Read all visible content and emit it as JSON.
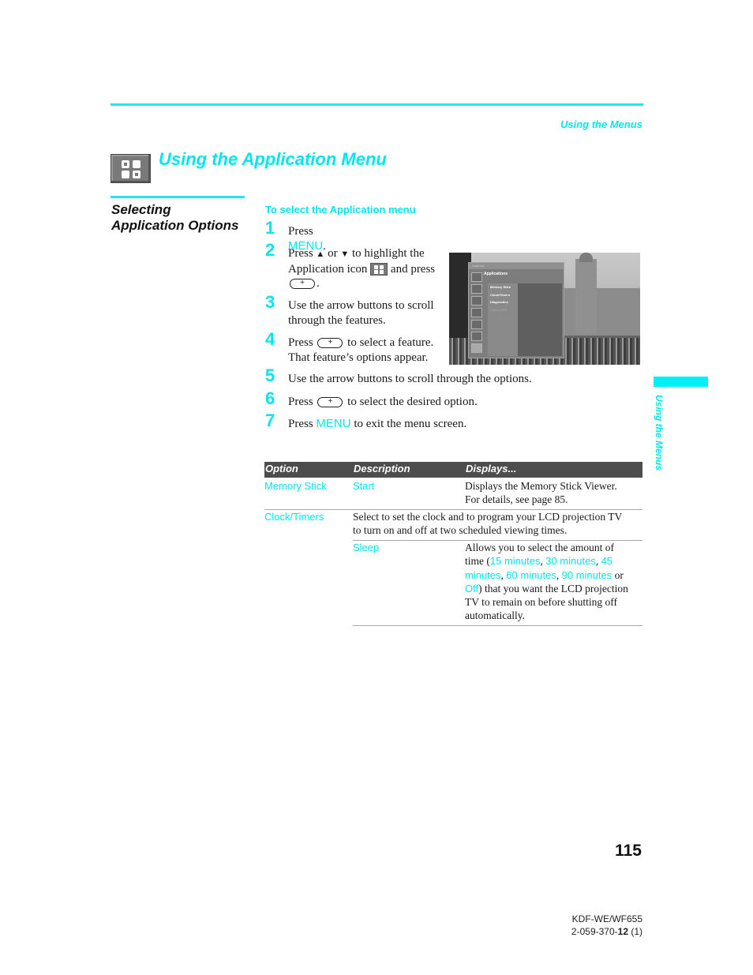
{
  "header": {
    "running_head": "Using the Menus",
    "page_title": "Using the Application Menu",
    "title_icon": "application-menu-icon"
  },
  "section": {
    "title_line1": "Selecting",
    "title_line2": "Application Options"
  },
  "procedure": {
    "heading": "To select the Application menu",
    "steps": [
      {
        "num": "1",
        "pre": "Press ",
        "kw": "MENU",
        "post": "."
      },
      {
        "num": "2",
        "line1_a": "Press ",
        "up_icon": "▲",
        "line1_b": " or ",
        "down_icon": "▼",
        "line1_c": " to highlight the",
        "line2_a": "Application icon ",
        "line2_b": " and press",
        "line3": "."
      },
      {
        "num": "3",
        "line1": "Use the arrow buttons to scroll",
        "line2": "through the features."
      },
      {
        "num": "4",
        "line1_a": "Press ",
        "line1_b": " to select a feature.",
        "line2": "That feature’s options appear."
      },
      {
        "num": "5",
        "text": "Use the arrow buttons to scroll through the options."
      },
      {
        "num": "6",
        "pre": "Press ",
        "post": " to select the desired option."
      },
      {
        "num": "7",
        "pre": "Press ",
        "kw": "MENU",
        "post": " to exit the menu screen."
      }
    ]
  },
  "tv_screen": {
    "top_bar": "Antenna",
    "menu_title": "Applications",
    "items": [
      "Memory Stick",
      "Clock/Timers",
      "Diagnostics",
      "CableCARD"
    ],
    "disabled_item": "CableCARD"
  },
  "table": {
    "headers": [
      "Option",
      "Description",
      "Displays..."
    ],
    "rows": [
      {
        "option": "Memory Stick",
        "description": "Start",
        "displays_line1": "Displays the Memory Stick Viewer.",
        "displays_line2": "For details, see page 85."
      },
      {
        "option": "Clock/Timers",
        "description_line1": "Select to set the clock and to program your LCD projection TV",
        "description_line2": "to turn on and off at two scheduled viewing times."
      },
      {
        "option": "",
        "description": "Sleep",
        "displays": {
          "l1": "Allows you to select the amount of",
          "l2_a": "time (",
          "opt1": "15 minutes",
          "sep1": ", ",
          "opt2": "30 minutes",
          "sep2": ", ",
          "opt3a": "45",
          "opt3b": "minutes",
          "sep3": ", ",
          "opt4": "60 minutes",
          "sep4": ", ",
          "opt5": "90 minutes",
          "l3_or": " or",
          "opt6": "Off",
          "l4_b": ") that you want the LCD projection",
          "l5": "TV to remain on before shutting off",
          "l6": "automatically."
        }
      }
    ]
  },
  "side_tab": {
    "label": "Using the Menus"
  },
  "footer": {
    "page_number": "115",
    "model": "KDF-WE/WF655",
    "code_prefix": "2-059-370-",
    "code_bold": "12",
    "code_suffix": " (1)"
  },
  "colors": {
    "accent": "#00e5ee",
    "table_header": "#4d4d4d"
  }
}
